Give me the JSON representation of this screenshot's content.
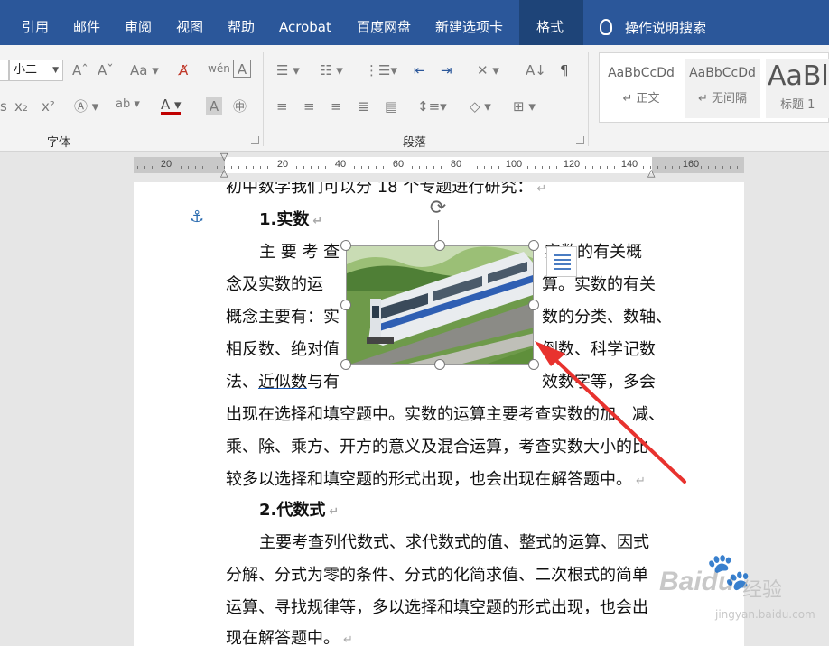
{
  "ribbon": {
    "tabs": [
      "引用",
      "邮件",
      "审阅",
      "视图",
      "帮助",
      "Acrobat",
      "百度网盘",
      "新建选项卡",
      "格式"
    ],
    "active_tab": "格式",
    "tell_me": "操作说明搜索",
    "font_size": "小二",
    "groups": {
      "font": "字体",
      "paragraph": "段落"
    },
    "font_icons": [
      "grow-font-icon",
      "shrink-font-icon",
      "change-case-icon",
      "clear-format-icon",
      "phonetic-guide-icon",
      "char-border-icon",
      "subscript-icon",
      "superscript-icon",
      "text-effects-icon",
      "highlight-icon",
      "font-color-icon",
      "char-shading-icon",
      "enclose-char-icon"
    ],
    "paragraph_icons": [
      "bullets-icon",
      "numbering-icon",
      "multilevel-list-icon",
      "decrease-indent-icon",
      "increase-indent-icon",
      "chinese-layout-icon",
      "sort-icon",
      "show-marks-icon",
      "align-left-icon",
      "center-icon",
      "align-right-icon",
      "justify-icon",
      "distributed-icon",
      "line-spacing-icon",
      "shading-icon",
      "borders-icon"
    ],
    "styles": [
      {
        "sample": "AaBbCcDd",
        "name": "正文"
      },
      {
        "sample": "AaBbCcDd",
        "name": "无间隔"
      },
      {
        "sample": "AaBl",
        "name": "标题 1"
      }
    ],
    "font_color": "#c00000"
  },
  "ruler": {
    "labels": [
      "20",
      "20",
      "40",
      "60",
      "80",
      "100",
      "120",
      "140",
      "160"
    ]
  },
  "document": {
    "lines": [
      "初中数学我们可以分 18 个专题进行研究：",
      "1.实数",
      "主 要 考 查",
      "实数的有关概",
      "念及实数的运",
      "算。实数的有关",
      "概念主要有：实",
      "数的分类、数轴、",
      "相反数、绝对值",
      "倒数、科学记数",
      "法、",
      "近似数",
      "与有",
      "效数字等，多会",
      "出现在选择和填空题中。实数的运算主要考查实数的加、减、",
      "乘、除、乘方、开方的意义及混合运算，考查实数大小的比",
      "较多以选择和填空题的形式出现，也会出现在解答题中。",
      "2.代数式",
      "主要考查列代数式、求代数式的值、整式的运算、因式",
      "分解、分式为零的条件、分式的化简求值、二次根式的简单",
      "运算、寻找规律等，多以选择和填空题的形式出现，也会出",
      "现在解答题中。"
    ],
    "paragraph_mark": "↵",
    "picture": {
      "alt": "train-photo"
    }
  },
  "watermark": {
    "brand": "Baidu",
    "jingyan": "经验",
    "url": "jingyan.baidu.com"
  },
  "colors": {
    "ribbon_blue": "#2b579a",
    "arrow_red": "#e8322e",
    "accent": "#1f5fbf"
  }
}
